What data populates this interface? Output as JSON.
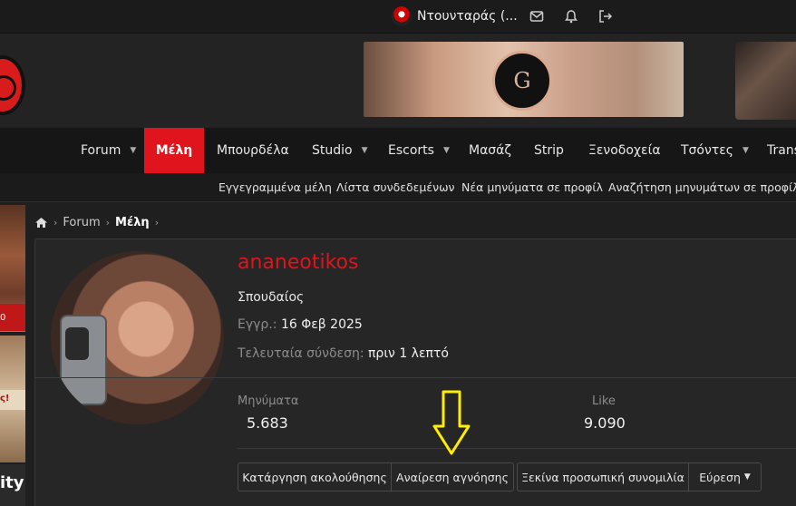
{
  "topbar": {
    "user_name": "Ντουνταράς (...",
    "icons": [
      "envelope-icon",
      "bell-icon",
      "logout-icon"
    ]
  },
  "banner": {
    "badge_letter": "G"
  },
  "nav": {
    "items": [
      {
        "label": "Forum",
        "has_caret": true
      },
      {
        "label": "Μέλη",
        "active": true
      },
      {
        "label": "Μπουρδέλα"
      },
      {
        "label": "Studio",
        "has_caret": true
      },
      {
        "label": "Escorts",
        "has_caret": true
      },
      {
        "label": "Μασάζ"
      },
      {
        "label": "Strip"
      },
      {
        "label": "Ξενοδοχεία"
      },
      {
        "label": "Τσόντες",
        "has_caret": true
      },
      {
        "label": "Trans"
      }
    ],
    "caret": "▼"
  },
  "subnav": {
    "items": [
      "Εγγεγραμμένα μέλη",
      "Λίστα συνδεδεμένων",
      "Νέα μηνύματα σε προφίλ",
      "Αναζήτηση μηνυμάτων σε προφίλ"
    ]
  },
  "side": {
    "red_text": "0",
    "red2_text": "ς!",
    "thumb3_text": "ity"
  },
  "breadcrumb": {
    "forum": "Forum",
    "current": "Μέλη",
    "sep": "›"
  },
  "profile": {
    "username": "ananeotikos",
    "rank": "Σπουδαίος",
    "joined_label": "Εγγρ.:",
    "joined_value": "16 Φεβ 2025",
    "lastseen_label": "Τελευταία σύνδεση:",
    "lastseen_value": "πριν 1 λεπτό",
    "stats": [
      {
        "label": "Μηνύματα",
        "value": "5.683"
      },
      {
        "label": "Like",
        "value": "9.090"
      }
    ]
  },
  "actions": {
    "unfollow": "Κατάργηση ακολούθησης",
    "unignore": "Αναίρεση αγνόησης",
    "start_conversation": "Ξεκίνα προσωπική συνομιλία",
    "find": "Εύρεση",
    "find_caret": "▼"
  },
  "colors": {
    "accent": "#e0141c",
    "annotation_arrow": "#ffee00"
  }
}
